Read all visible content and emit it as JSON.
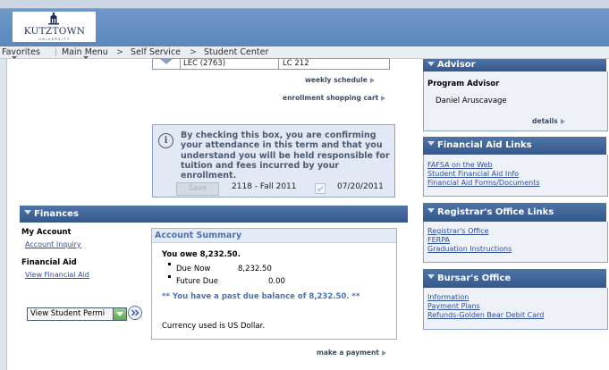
{
  "header": {
    "logo_text": "KUTZTOWN",
    "logo_subtext": "UNIVERSITY"
  },
  "nav": {
    "favorites": "Favorites",
    "main_menu": "Main Menu",
    "sep1": ">",
    "self_service": "Self Service",
    "sep2": ">",
    "student_center": "Student Center"
  },
  "schedule": {
    "row_class": "LEC (2763)",
    "row_room": "LC 212",
    "weekly_schedule": "weekly schedule",
    "shopping_cart": "enrollment shopping cart"
  },
  "confirm": {
    "text": "By checking this box, you are confirming your attendance in this term and that you understand you will be held responsible for tuition and fees incurred by your enrollment.",
    "save": "Save",
    "term": "2118 - Fall 2011",
    "date": "07/20/2011",
    "checked": true
  },
  "finances": {
    "title": "Finances",
    "my_account": "My Account",
    "account_inquiry": "Account Inquiry",
    "financial_aid": "Financial Aid",
    "view_financial_aid": "View Financial Aid",
    "select_value": "View Student Permi",
    "summary": {
      "title": "Account Summary",
      "you_owe": "You owe 8,232.50.",
      "due_now_label": "Due Now",
      "due_now_value": "8,232.50",
      "future_due_label": "Future Due",
      "future_due_value": "0.00",
      "past_due": "** You have a past due balance of 8,232.50. **",
      "currency": "Currency used is US Dollar."
    },
    "make_payment": "make a payment"
  },
  "advisor": {
    "title": "Advisor",
    "label": "Program Advisor",
    "name": "Daniel Aruscavage",
    "details": "details"
  },
  "financial_aid_links": {
    "title": "Financial Aid Links",
    "items": [
      "FAFSA on the Web",
      "Student Financial Aid Info",
      "Financial Aid Forms/Documents"
    ]
  },
  "registrar_links": {
    "title": "Registrar's Office Links",
    "items": [
      "Registrar's Office",
      "FERPA",
      "Graduation Instructions"
    ]
  },
  "bursar": {
    "title": "Bursar's Office",
    "items": [
      "Information",
      "Payment Plans",
      "Refunds-Golden Bear Debit Card"
    ]
  },
  "colors": {
    "header_blue": "#5b87bd",
    "section_header": "#3f6499",
    "link": "#2e4e97",
    "panel_bg": "#eef2f8"
  }
}
